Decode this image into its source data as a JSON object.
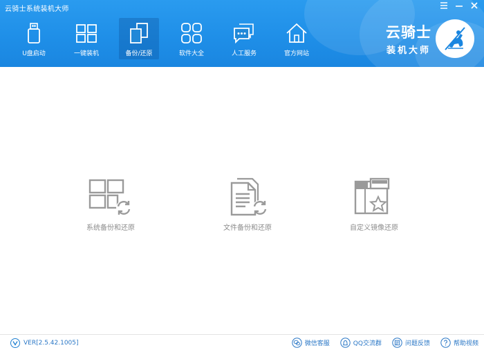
{
  "window": {
    "title": "云骑士系统装机大师",
    "menu_icon": "menu-icon",
    "minimize_icon": "minimize-icon",
    "close_icon": "close-icon"
  },
  "nav": {
    "items": [
      {
        "label": "U盘启动",
        "icon": "usb-drive-icon"
      },
      {
        "label": "一键装机",
        "icon": "windows-icon"
      },
      {
        "label": "备份/还原",
        "icon": "backup-restore-icon",
        "active": true
      },
      {
        "label": "软件大全",
        "icon": "apps-grid-icon"
      },
      {
        "label": "人工服务",
        "icon": "chat-icon"
      },
      {
        "label": "官方网站",
        "icon": "home-icon"
      }
    ]
  },
  "brand": {
    "name": "云骑士",
    "tagline": "装机大师",
    "logo": "knight-logo-icon"
  },
  "main": {
    "features": [
      {
        "label": "系统备份和还原",
        "icon": "system-backup-icon"
      },
      {
        "label": "文件备份和还原",
        "icon": "file-backup-icon"
      },
      {
        "label": "自定义镜像还原",
        "icon": "custom-image-restore-icon"
      }
    ]
  },
  "footer": {
    "version": "VER[2.5.42.1005]",
    "links": [
      {
        "label": "微信客服",
        "icon": "wechat-icon"
      },
      {
        "label": "QQ交流群",
        "icon": "qq-group-icon"
      },
      {
        "label": "问题反馈",
        "icon": "feedback-icon"
      },
      {
        "label": "帮助视频",
        "icon": "help-icon"
      }
    ]
  },
  "colors": {
    "header_bg": "#1f8fe8",
    "feature_icon": "#9a9a9a",
    "link_text": "#2a77c6"
  }
}
